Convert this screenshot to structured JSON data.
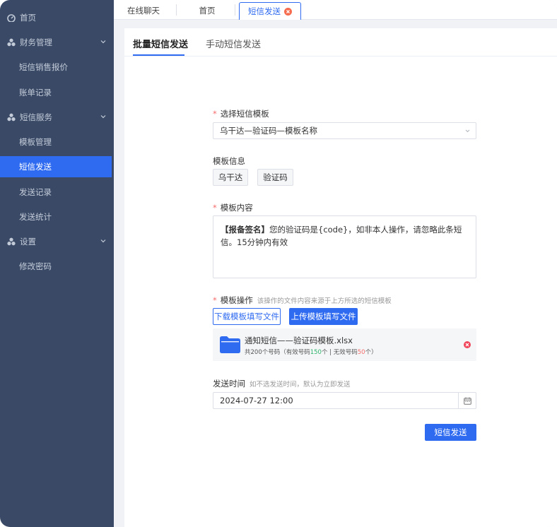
{
  "sidebar": {
    "items": [
      {
        "label": "首页",
        "type": "top",
        "icon": "home-icon"
      },
      {
        "label": "财务管理",
        "type": "group",
        "icon": "cluster-icon"
      },
      {
        "label": "短信销售报价",
        "type": "sub"
      },
      {
        "label": "账单记录",
        "type": "sub"
      },
      {
        "label": "短信服务",
        "type": "group",
        "icon": "cluster-icon"
      },
      {
        "label": "模板管理",
        "type": "sub"
      },
      {
        "label": "短信发送",
        "type": "sub",
        "active": true
      },
      {
        "label": "发送记录",
        "type": "sub"
      },
      {
        "label": "发送统计",
        "type": "sub"
      },
      {
        "label": "设置",
        "type": "group",
        "icon": "cluster-icon"
      },
      {
        "label": "修改密码",
        "type": "sub"
      }
    ]
  },
  "tabs": {
    "chat": "在线聊天",
    "home": "首页",
    "sms_send": "短信发送"
  },
  "subtabs": {
    "batch": "批量短信发送",
    "manual": "手动短信发送"
  },
  "form": {
    "template_label": "选择短信模板",
    "template_value": "乌干达—验证码—模板名称",
    "template_info_label": "模板信息",
    "tags": [
      "乌干达",
      "验证码"
    ],
    "content_label": "模板内容",
    "content_signature": "【报备签名】",
    "content_text": "您的验证码是{code}，如非本人操作，请忽略此条短信。15分钟内有效",
    "operation_label": "模板操作",
    "operation_hint": "该操作的文件内容来源于上方所选的短信模板",
    "download_button": "下载模板填写文件",
    "upload_button": "上传模板填写文件",
    "file_name": "通知短信——验证码模板.xlsx",
    "file_meta_prefix": "共200个号码（有效号码",
    "file_valid": "150",
    "file_meta_mid": "个 | 无效号码",
    "file_invalid": "50",
    "file_meta_suffix": "个）",
    "send_time_label": "发送时间",
    "send_time_hint": "如不选发送时间，默认为立即发送",
    "send_time_value": "2024-07-27 12:00",
    "submit_button": "短信发送"
  },
  "colors": {
    "sidebar_bg": "#3a4a66",
    "accent": "#2f6bf0",
    "danger": "#f56c6c",
    "success": "#2fb36b"
  }
}
